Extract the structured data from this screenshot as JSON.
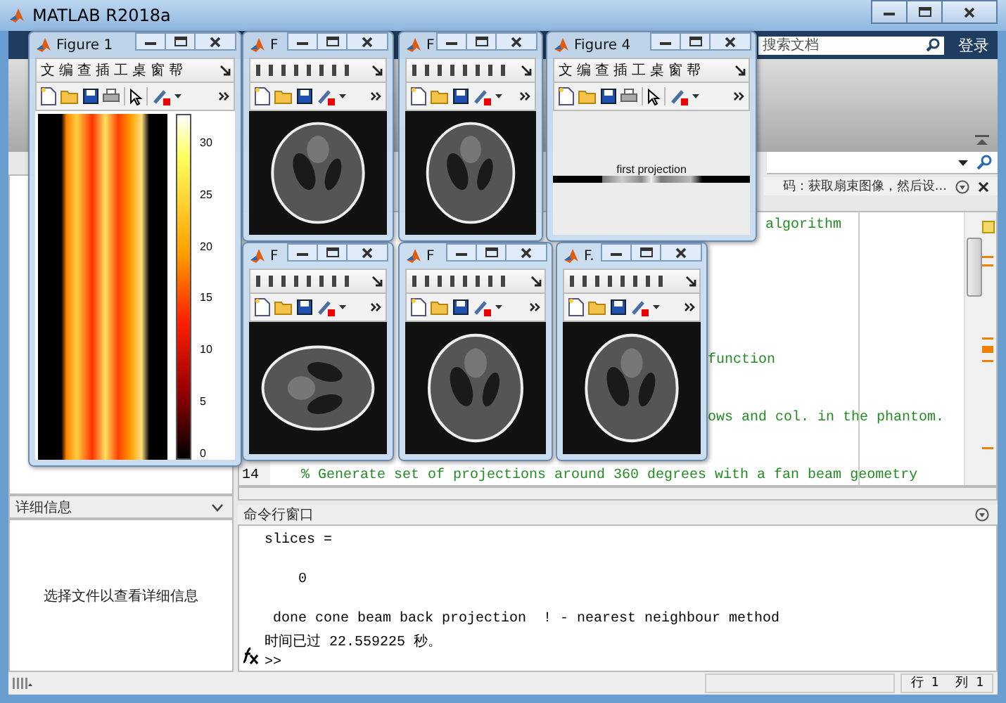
{
  "window": {
    "title": "MATLAB R2018a"
  },
  "toolstrip": {
    "search_placeholder": "搜索文档",
    "login": "登录"
  },
  "editor": {
    "hint": "码：获取扇束图像，然后设...",
    "lines": [
      {
        "kind": "fragment",
        "text": "algorithm"
      },
      {
        "kind": "fragment",
        "text": "function"
      },
      {
        "kind": "fragment",
        "text": "ows and col. in the phantom."
      },
      {
        "kind": "code",
        "number": "14",
        "text": "% Generate set of projections around 360 degrees with a fan beam geometry"
      }
    ]
  },
  "details_panel": {
    "title": "详细信息",
    "message": "选择文件以查看详细信息"
  },
  "command_window": {
    "title": "命令行窗口",
    "prompt": ">>",
    "lines": [
      {
        "kind": "output",
        "text": "slices ="
      },
      {
        "kind": "value",
        "text": "0"
      },
      {
        "kind": "output",
        "text": " done cone beam back projection  ! - nearest neighbour method"
      },
      {
        "kind": "output",
        "text": "时间已过 22.559225 秒。"
      }
    ]
  },
  "status_bar": {
    "row": "行 1",
    "column": "列 1"
  },
  "figures": [
    {
      "title": "Figure 1",
      "kind": "sinogram",
      "menu": [
        "文",
        "编",
        "查",
        "插",
        "工",
        "桌",
        "窗",
        "帮"
      ],
      "colorbar_ticks": [
        "30",
        "25",
        "20",
        "15",
        "10",
        "5",
        "0"
      ]
    },
    {
      "title": "F",
      "kind": "phantom"
    },
    {
      "title": "F",
      "kind": "phantom"
    },
    {
      "title": "Figure 4",
      "kind": "projection",
      "menu": [
        "文",
        "编",
        "查",
        "插",
        "工",
        "桌",
        "窗",
        "帮"
      ],
      "axes_title": "first projection"
    },
    {
      "title": "F",
      "kind": "phantom_wide"
    },
    {
      "title": "F",
      "kind": "phantom"
    },
    {
      "title": "F.",
      "kind": "phantom"
    }
  ]
}
